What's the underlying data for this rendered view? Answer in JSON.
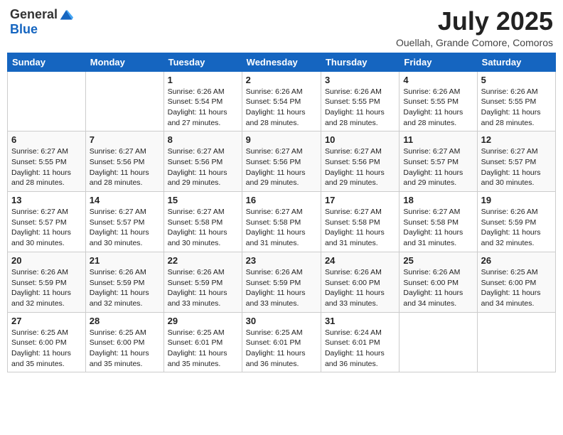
{
  "logo": {
    "general": "General",
    "blue": "Blue"
  },
  "title": "July 2025",
  "location": "Ouellah, Grande Comore, Comoros",
  "weekdays": [
    "Sunday",
    "Monday",
    "Tuesday",
    "Wednesday",
    "Thursday",
    "Friday",
    "Saturday"
  ],
  "weeks": [
    [
      {
        "day": null,
        "info": ""
      },
      {
        "day": null,
        "info": ""
      },
      {
        "day": "1",
        "sunrise": "Sunrise: 6:26 AM",
        "sunset": "Sunset: 5:54 PM",
        "daylight": "Daylight: 11 hours and 27 minutes."
      },
      {
        "day": "2",
        "sunrise": "Sunrise: 6:26 AM",
        "sunset": "Sunset: 5:54 PM",
        "daylight": "Daylight: 11 hours and 28 minutes."
      },
      {
        "day": "3",
        "sunrise": "Sunrise: 6:26 AM",
        "sunset": "Sunset: 5:55 PM",
        "daylight": "Daylight: 11 hours and 28 minutes."
      },
      {
        "day": "4",
        "sunrise": "Sunrise: 6:26 AM",
        "sunset": "Sunset: 5:55 PM",
        "daylight": "Daylight: 11 hours and 28 minutes."
      },
      {
        "day": "5",
        "sunrise": "Sunrise: 6:26 AM",
        "sunset": "Sunset: 5:55 PM",
        "daylight": "Daylight: 11 hours and 28 minutes."
      }
    ],
    [
      {
        "day": "6",
        "sunrise": "Sunrise: 6:27 AM",
        "sunset": "Sunset: 5:55 PM",
        "daylight": "Daylight: 11 hours and 28 minutes."
      },
      {
        "day": "7",
        "sunrise": "Sunrise: 6:27 AM",
        "sunset": "Sunset: 5:56 PM",
        "daylight": "Daylight: 11 hours and 28 minutes."
      },
      {
        "day": "8",
        "sunrise": "Sunrise: 6:27 AM",
        "sunset": "Sunset: 5:56 PM",
        "daylight": "Daylight: 11 hours and 29 minutes."
      },
      {
        "day": "9",
        "sunrise": "Sunrise: 6:27 AM",
        "sunset": "Sunset: 5:56 PM",
        "daylight": "Daylight: 11 hours and 29 minutes."
      },
      {
        "day": "10",
        "sunrise": "Sunrise: 6:27 AM",
        "sunset": "Sunset: 5:56 PM",
        "daylight": "Daylight: 11 hours and 29 minutes."
      },
      {
        "day": "11",
        "sunrise": "Sunrise: 6:27 AM",
        "sunset": "Sunset: 5:57 PM",
        "daylight": "Daylight: 11 hours and 29 minutes."
      },
      {
        "day": "12",
        "sunrise": "Sunrise: 6:27 AM",
        "sunset": "Sunset: 5:57 PM",
        "daylight": "Daylight: 11 hours and 30 minutes."
      }
    ],
    [
      {
        "day": "13",
        "sunrise": "Sunrise: 6:27 AM",
        "sunset": "Sunset: 5:57 PM",
        "daylight": "Daylight: 11 hours and 30 minutes."
      },
      {
        "day": "14",
        "sunrise": "Sunrise: 6:27 AM",
        "sunset": "Sunset: 5:57 PM",
        "daylight": "Daylight: 11 hours and 30 minutes."
      },
      {
        "day": "15",
        "sunrise": "Sunrise: 6:27 AM",
        "sunset": "Sunset: 5:58 PM",
        "daylight": "Daylight: 11 hours and 30 minutes."
      },
      {
        "day": "16",
        "sunrise": "Sunrise: 6:27 AM",
        "sunset": "Sunset: 5:58 PM",
        "daylight": "Daylight: 11 hours and 31 minutes."
      },
      {
        "day": "17",
        "sunrise": "Sunrise: 6:27 AM",
        "sunset": "Sunset: 5:58 PM",
        "daylight": "Daylight: 11 hours and 31 minutes."
      },
      {
        "day": "18",
        "sunrise": "Sunrise: 6:27 AM",
        "sunset": "Sunset: 5:58 PM",
        "daylight": "Daylight: 11 hours and 31 minutes."
      },
      {
        "day": "19",
        "sunrise": "Sunrise: 6:26 AM",
        "sunset": "Sunset: 5:59 PM",
        "daylight": "Daylight: 11 hours and 32 minutes."
      }
    ],
    [
      {
        "day": "20",
        "sunrise": "Sunrise: 6:26 AM",
        "sunset": "Sunset: 5:59 PM",
        "daylight": "Daylight: 11 hours and 32 minutes."
      },
      {
        "day": "21",
        "sunrise": "Sunrise: 6:26 AM",
        "sunset": "Sunset: 5:59 PM",
        "daylight": "Daylight: 11 hours and 32 minutes."
      },
      {
        "day": "22",
        "sunrise": "Sunrise: 6:26 AM",
        "sunset": "Sunset: 5:59 PM",
        "daylight": "Daylight: 11 hours and 33 minutes."
      },
      {
        "day": "23",
        "sunrise": "Sunrise: 6:26 AM",
        "sunset": "Sunset: 5:59 PM",
        "daylight": "Daylight: 11 hours and 33 minutes."
      },
      {
        "day": "24",
        "sunrise": "Sunrise: 6:26 AM",
        "sunset": "Sunset: 6:00 PM",
        "daylight": "Daylight: 11 hours and 33 minutes."
      },
      {
        "day": "25",
        "sunrise": "Sunrise: 6:26 AM",
        "sunset": "Sunset: 6:00 PM",
        "daylight": "Daylight: 11 hours and 34 minutes."
      },
      {
        "day": "26",
        "sunrise": "Sunrise: 6:25 AM",
        "sunset": "Sunset: 6:00 PM",
        "daylight": "Daylight: 11 hours and 34 minutes."
      }
    ],
    [
      {
        "day": "27",
        "sunrise": "Sunrise: 6:25 AM",
        "sunset": "Sunset: 6:00 PM",
        "daylight": "Daylight: 11 hours and 35 minutes."
      },
      {
        "day": "28",
        "sunrise": "Sunrise: 6:25 AM",
        "sunset": "Sunset: 6:00 PM",
        "daylight": "Daylight: 11 hours and 35 minutes."
      },
      {
        "day": "29",
        "sunrise": "Sunrise: 6:25 AM",
        "sunset": "Sunset: 6:01 PM",
        "daylight": "Daylight: 11 hours and 35 minutes."
      },
      {
        "day": "30",
        "sunrise": "Sunrise: 6:25 AM",
        "sunset": "Sunset: 6:01 PM",
        "daylight": "Daylight: 11 hours and 36 minutes."
      },
      {
        "day": "31",
        "sunrise": "Sunrise: 6:24 AM",
        "sunset": "Sunset: 6:01 PM",
        "daylight": "Daylight: 11 hours and 36 minutes."
      },
      {
        "day": null,
        "info": ""
      },
      {
        "day": null,
        "info": ""
      }
    ]
  ]
}
